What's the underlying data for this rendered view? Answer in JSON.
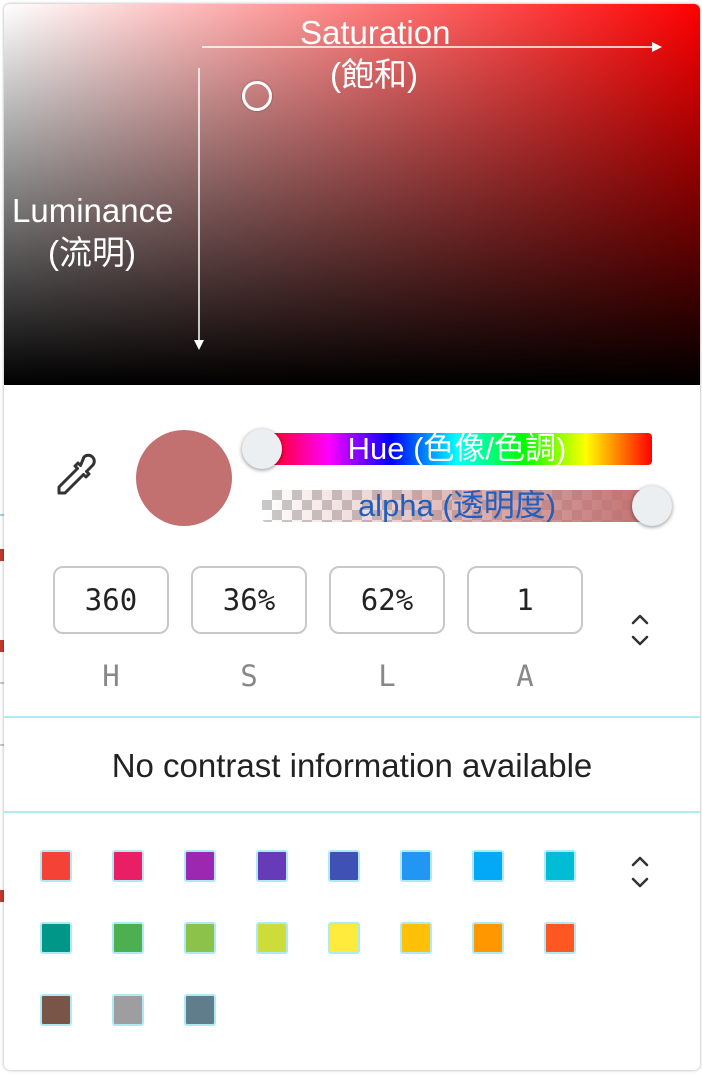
{
  "picker": {
    "saturation_label": "Saturation",
    "saturation_sub": "(飽和)",
    "luminance_label": "Luminance",
    "luminance_sub": "(流明)",
    "hue_label": "Hue (色像/色調)",
    "alpha_label": "alpha (透明度)",
    "current_color": "#c27070",
    "hue_position": 0.0,
    "alpha_position": 1.0
  },
  "values": [
    {
      "value": "360",
      "label": "H"
    },
    {
      "value": "36%",
      "label": "S"
    },
    {
      "value": "62%",
      "label": "L"
    },
    {
      "value": "1",
      "label": "A"
    }
  ],
  "contrast": {
    "message": "No contrast information available"
  },
  "palette": [
    "#f44336",
    "#e91e63",
    "#9c27b0",
    "#673ab7",
    "#3f51b5",
    "#2196f3",
    "#03a9f4",
    "#00bcd4",
    "#009688",
    "#4caf50",
    "#8bc34a",
    "#cddc39",
    "#ffeb3b",
    "#ffc107",
    "#ff9800",
    "#ff5722",
    "#795548",
    "#9e9e9e",
    "#607d8b"
  ],
  "icons": {
    "eyedropper": "eyedropper-icon",
    "format_toggle": "chevron-up-down-icon",
    "palette_toggle": "chevron-up-down-icon"
  }
}
